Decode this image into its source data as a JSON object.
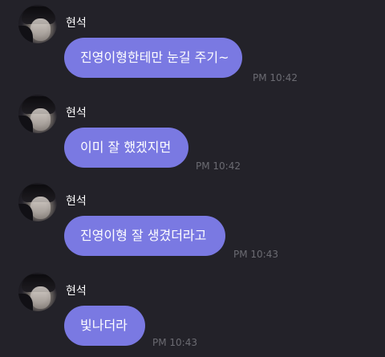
{
  "colors": {
    "background": "#232229",
    "bubble": "#7a79e2",
    "name_text": "#ffffff",
    "message_text": "#ffffff",
    "timestamp_text": "#6b6b72"
  },
  "messages": [
    {
      "sender": "현석",
      "text": "진영이형한테만 눈길 주기~",
      "time": "PM 10:42"
    },
    {
      "sender": "현석",
      "text": "이미 잘 했겠지먼",
      "time": "PM 10:42"
    },
    {
      "sender": "현석",
      "text": "진영이형 잘 생겼더라고",
      "time": "PM 10:43"
    },
    {
      "sender": "현석",
      "text": "빛나더라",
      "time": "PM 10:43"
    }
  ]
}
